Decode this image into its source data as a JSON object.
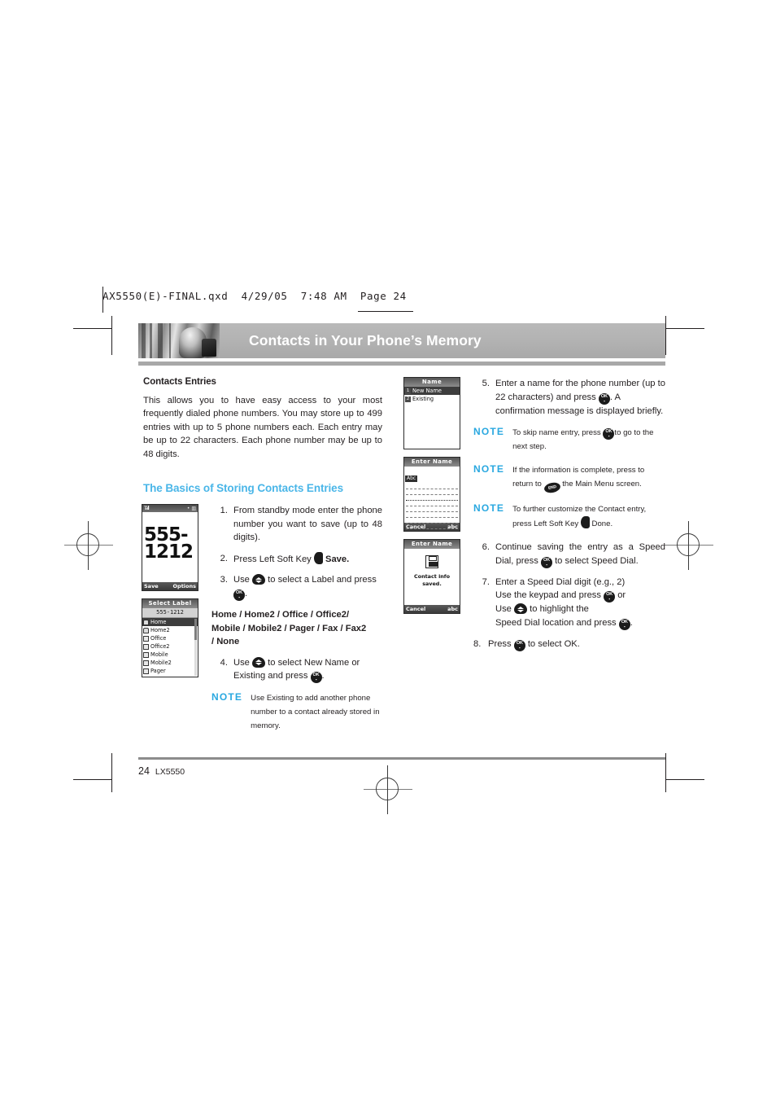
{
  "prepress": {
    "header": "AX5550(E)-FINAL.qxd  4/29/05  7:48 AM  Page 24"
  },
  "header": {
    "title": "Contacts in Your Phone’s Memory",
    "photo_alt": "escalator-photo"
  },
  "left": {
    "section_heading": "Contacts Entries",
    "intro": "This allows you to have easy access to your most frequently dialed phone numbers. You may store up to 499 entries with up to 5 phone numbers each. Each entry may be up to 22 characters. Each phone number may be up to 48 digits.",
    "blue_heading": "The Basics of Storing Contacts Entries",
    "steps": [
      {
        "n": "1.",
        "text": "From standby mode enter the phone number you want to save (up to 48 digits)."
      },
      {
        "n": "2.",
        "text_before": "Press Left Soft Key",
        "icon": "left-soft-key",
        "text_after": "Save."
      },
      {
        "n": "3.",
        "text_before": "Use",
        "icon": "nav-key",
        "text_mid": "to select a Label and press",
        "icon2": "ok-key",
        "text_after": "."
      },
      {
        "n": "4.",
        "text_before": "Use",
        "icon": "nav-key",
        "text_mid": "to select New Name or Existing and press",
        "icon2": "ok-key",
        "text_after": "."
      }
    ],
    "labels_line1": "Home / Home2 / Office / Office2/",
    "labels_line2": "Mobile / Mobile2 / Pager / Fax / Fax2",
    "labels_line3": "/ None",
    "note": {
      "label": "NOTE",
      "text": "Use Existing to add another phone number to a contact already stored in memory."
    },
    "screen_standby": {
      "signal": "Tall",
      "icons": "• ▥",
      "number": "555-1212",
      "softkey_left": "Save",
      "softkey_right": "Options"
    },
    "screen_label": {
      "title": "Select Label",
      "subtitle": "555-1212",
      "items": [
        "Home",
        "Home2",
        "Office",
        "Office2",
        "Mobile",
        "Mobile2",
        "Pager"
      ],
      "selected_index": 0
    }
  },
  "right": {
    "screen_name": {
      "title": "Name",
      "items": [
        {
          "num": "1",
          "label": "New Name"
        },
        {
          "num": "2",
          "label": "Existing"
        }
      ],
      "selected_index": 0
    },
    "screen_enter_name": {
      "title": "Enter Name",
      "mode_tag": "Abc",
      "softkey_left": "Cancel",
      "softkey_right": "abc"
    },
    "screen_saved": {
      "title": "Enter Name",
      "message_line1": "Contact info",
      "message_line2": "saved.",
      "softkey_left": "Cancel",
      "softkey_right": "abc"
    },
    "steps": [
      {
        "n": "5.",
        "text_before": "Enter a name for the phone number (up to 22 characters) and press",
        "icon": "ok-key",
        "text_after": ". A confirmation message is displayed briefly."
      },
      {
        "n": "6.",
        "text_before": "Continue saving the entry as a Speed Dial, press",
        "icon": "ok-key",
        "text_after": "to select Speed Dial."
      },
      {
        "n": "7.",
        "line1": "Enter a Speed Dial digit (e.g., 2)",
        "line2_before": "Use the keypad and press",
        "line2_icon": "ok-key",
        "line2_after": "or",
        "line3_before": "Use",
        "line3_icon": "nav-key",
        "line3_after": "to highlight the",
        "line4_before": "Speed Dial location and press",
        "line4_icon": "ok-key",
        "line4_after": "."
      },
      {
        "n": "8.",
        "text_before": "Press",
        "icon": "ok-key",
        "text_after": "to select OK."
      }
    ],
    "notes": [
      {
        "label": "NOTE",
        "text_before": "To skip name entry, press",
        "icon": "ok-key",
        "text_after": "to go to the next step."
      },
      {
        "label": "NOTE",
        "text_before": "If the information is complete, press  to return to",
        "icon": "end-key",
        "text_after": "the Main Menu screen."
      },
      {
        "label": "NOTE",
        "text_before": "To further customize the Contact entry, press Left Soft Key",
        "icon": "left-soft-key",
        "text_after": "Done."
      }
    ]
  },
  "footer": {
    "page_number": "24",
    "model": "LX5550"
  },
  "icons": {
    "ok_key_top": "OK",
    "ok_key_bottom": "⬛",
    "end_key_label": "END"
  },
  "colors": {
    "accent_blue": "#4ab6e8",
    "note_blue": "#2aa8e0",
    "title_band": "#b3b3b3",
    "text": "#231f20"
  }
}
